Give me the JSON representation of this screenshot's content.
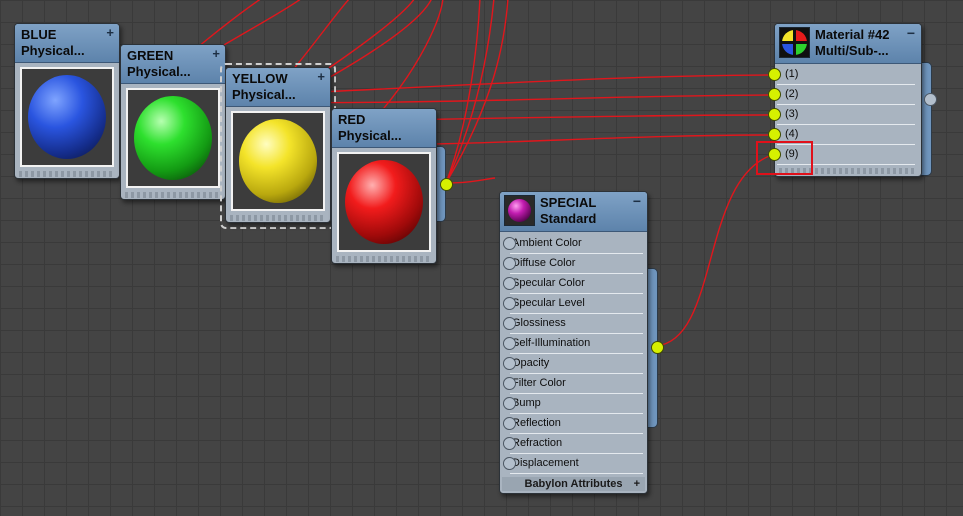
{
  "nodes": {
    "blue": {
      "name": "BLUE",
      "type": "Physical..."
    },
    "green": {
      "name": "GREEN",
      "type": "Physical..."
    },
    "yellow": {
      "name": "YELLOW",
      "type": "Physical..."
    },
    "red": {
      "name": "RED",
      "type": "Physical..."
    },
    "special": {
      "name": "SPECIAL",
      "type": "Standard",
      "slots": [
        "Ambient Color",
        "Diffuse Color",
        "Specular Color",
        "Specular Level",
        "Glossiness",
        "Self-Illumination",
        "Opacity",
        "Filter Color",
        "Bump",
        "Reflection",
        "Refraction",
        "Displacement"
      ],
      "footer": "Babylon Attributes",
      "footer_plus": "+"
    },
    "multi": {
      "name": "Material #42",
      "type": "Multi/Sub-...",
      "slots": [
        "(1)",
        "(2)",
        "(3)",
        "(4)",
        "(9)"
      ]
    }
  },
  "controls": {
    "plus": "+",
    "minus": "−"
  },
  "colors": {
    "wire": "#e0161c",
    "socket": "#d6f000",
    "header": "#6a8fb8",
    "highlight": "#e0101a"
  }
}
